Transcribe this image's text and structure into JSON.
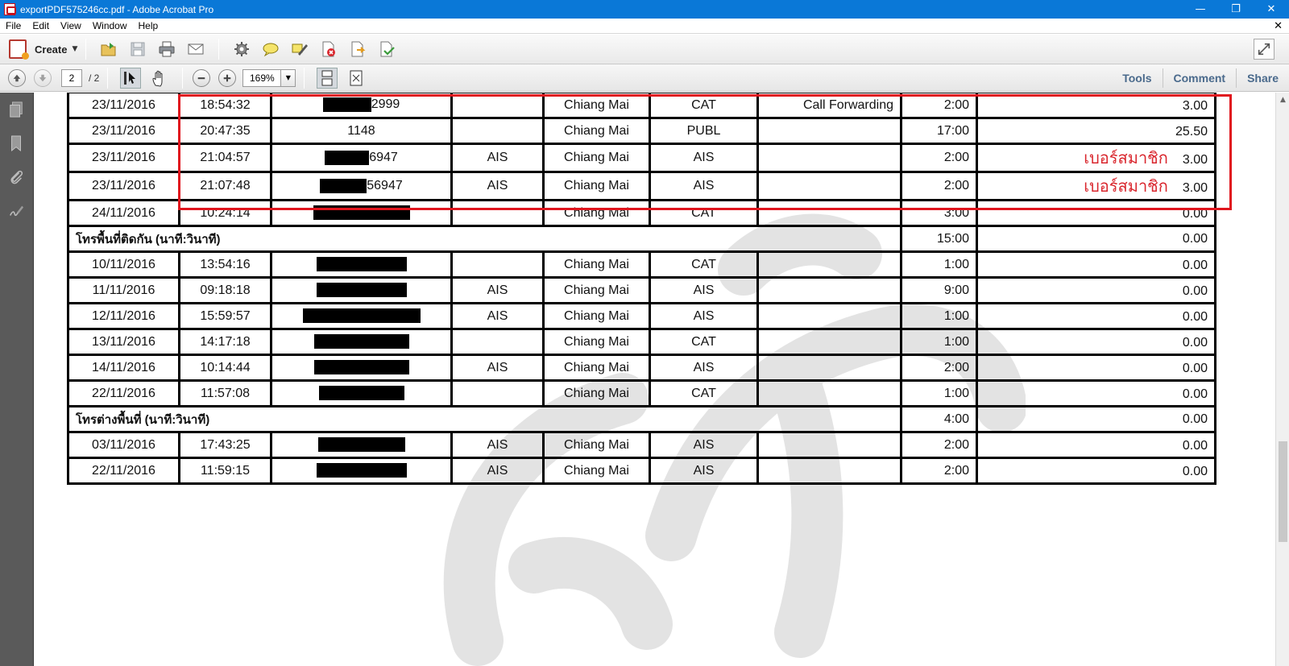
{
  "window": {
    "title": "exportPDF575246cc.pdf - Adobe Acrobat Pro",
    "minimize": "—",
    "restore": "❐",
    "close": "✕"
  },
  "menu": {
    "items": [
      "File",
      "Edit",
      "View",
      "Window",
      "Help"
    ],
    "close_glyph": "✕"
  },
  "toolbar": {
    "create_label": "Create",
    "caret": "▼"
  },
  "nav": {
    "current_page": "2",
    "page_total": "/ 2",
    "zoom": "169%",
    "zoom_caret": "▼"
  },
  "panel_links": {
    "tools": "Tools",
    "comment": "Comment",
    "share": "Share"
  },
  "colors": {
    "titlebar": "#0a78d7",
    "highlight_box": "#e0161e",
    "note_text": "#d9262d",
    "link_text": "#4a6a8c"
  },
  "table": {
    "rows": [
      {
        "type": "call",
        "date": "23/11/2016",
        "time": "18:54:32",
        "number_visible": "2999",
        "redact_w": 60,
        "operator": "",
        "area": "Chiang Mai",
        "network": "CAT",
        "service": "Call Forwarding",
        "duration": "2:00",
        "note": "",
        "amount": "3.00"
      },
      {
        "type": "call",
        "date": "23/11/2016",
        "time": "20:47:35",
        "number_visible": "1148",
        "redact_w": 0,
        "operator": "",
        "area": "Chiang Mai",
        "network": "PUBL",
        "service": "",
        "duration": "17:00",
        "note": "",
        "amount": "25.50"
      },
      {
        "type": "call",
        "date": "23/11/2016",
        "time": "21:04:57",
        "number_visible": "6947",
        "redact_w": 55,
        "operator": "AIS",
        "area": "Chiang Mai",
        "network": "AIS",
        "service": "",
        "duration": "2:00",
        "note": "เบอร์สมาชิก",
        "amount": "3.00"
      },
      {
        "type": "call",
        "date": "23/11/2016",
        "time": "21:07:48",
        "number_visible": "56947",
        "redact_w": 58,
        "operator": "AIS",
        "area": "Chiang Mai",
        "network": "AIS",
        "service": "",
        "duration": "2:00",
        "note": "เบอร์สมาชิก",
        "amount": "3.00"
      },
      {
        "type": "call",
        "date": "24/11/2016",
        "time": "10:24:14",
        "number_visible": "",
        "redact_w": 120,
        "operator": "",
        "area": "Chiang Mai",
        "network": "CAT",
        "service": "",
        "duration": "3:00",
        "note": "",
        "amount": "0.00"
      },
      {
        "type": "section",
        "label": "โทรพื้นที่ติดกัน (นาที:วินาที)",
        "duration": "15:00",
        "amount": "0.00"
      },
      {
        "type": "call",
        "date": "10/11/2016",
        "time": "13:54:16",
        "number_visible": "",
        "redact_w": 112,
        "operator": "",
        "area": "Chiang Mai",
        "network": "CAT",
        "service": "",
        "duration": "1:00",
        "note": "",
        "amount": "0.00"
      },
      {
        "type": "call",
        "date": "11/11/2016",
        "time": "09:18:18",
        "number_visible": "",
        "redact_w": 112,
        "operator": "AIS",
        "area": "Chiang Mai",
        "network": "AIS",
        "service": "",
        "duration": "9:00",
        "note": "",
        "amount": "0.00"
      },
      {
        "type": "call",
        "date": "12/11/2016",
        "time": "15:59:57",
        "number_visible": "",
        "redact_w": 146,
        "operator": "AIS",
        "area": "Chiang Mai",
        "network": "AIS",
        "service": "",
        "duration": "1:00",
        "note": "",
        "amount": "0.00"
      },
      {
        "type": "call",
        "date": "13/11/2016",
        "time": "14:17:18",
        "number_visible": "",
        "redact_w": 118,
        "operator": "",
        "area": "Chiang Mai",
        "network": "CAT",
        "service": "",
        "duration": "1:00",
        "note": "",
        "amount": "0.00"
      },
      {
        "type": "call",
        "date": "14/11/2016",
        "time": "10:14:44",
        "number_visible": "",
        "redact_w": 118,
        "operator": "AIS",
        "area": "Chiang Mai",
        "network": "AIS",
        "service": "",
        "duration": "2:00",
        "note": "",
        "amount": "0.00"
      },
      {
        "type": "call",
        "date": "22/11/2016",
        "time": "11:57:08",
        "number_visible": "",
        "redact_w": 106,
        "operator": "",
        "area": "Chiang Mai",
        "network": "CAT",
        "service": "",
        "duration": "1:00",
        "note": "",
        "amount": "0.00"
      },
      {
        "type": "section",
        "label": "โทรต่างพื้นที่ (นาที:วินาที)",
        "duration": "4:00",
        "amount": "0.00"
      },
      {
        "type": "call",
        "date": "03/11/2016",
        "time": "17:43:25",
        "number_visible": "",
        "redact_w": 108,
        "operator": "AIS",
        "area": "Chiang Mai",
        "network": "AIS",
        "service": "",
        "duration": "2:00",
        "note": "",
        "amount": "0.00"
      },
      {
        "type": "call",
        "date": "22/11/2016",
        "time": "11:59:15",
        "number_visible": "",
        "redact_w": 112,
        "operator": "AIS",
        "area": "Chiang Mai",
        "network": "AIS",
        "service": "",
        "duration": "2:00",
        "note": "",
        "amount": "0.00"
      }
    ]
  }
}
